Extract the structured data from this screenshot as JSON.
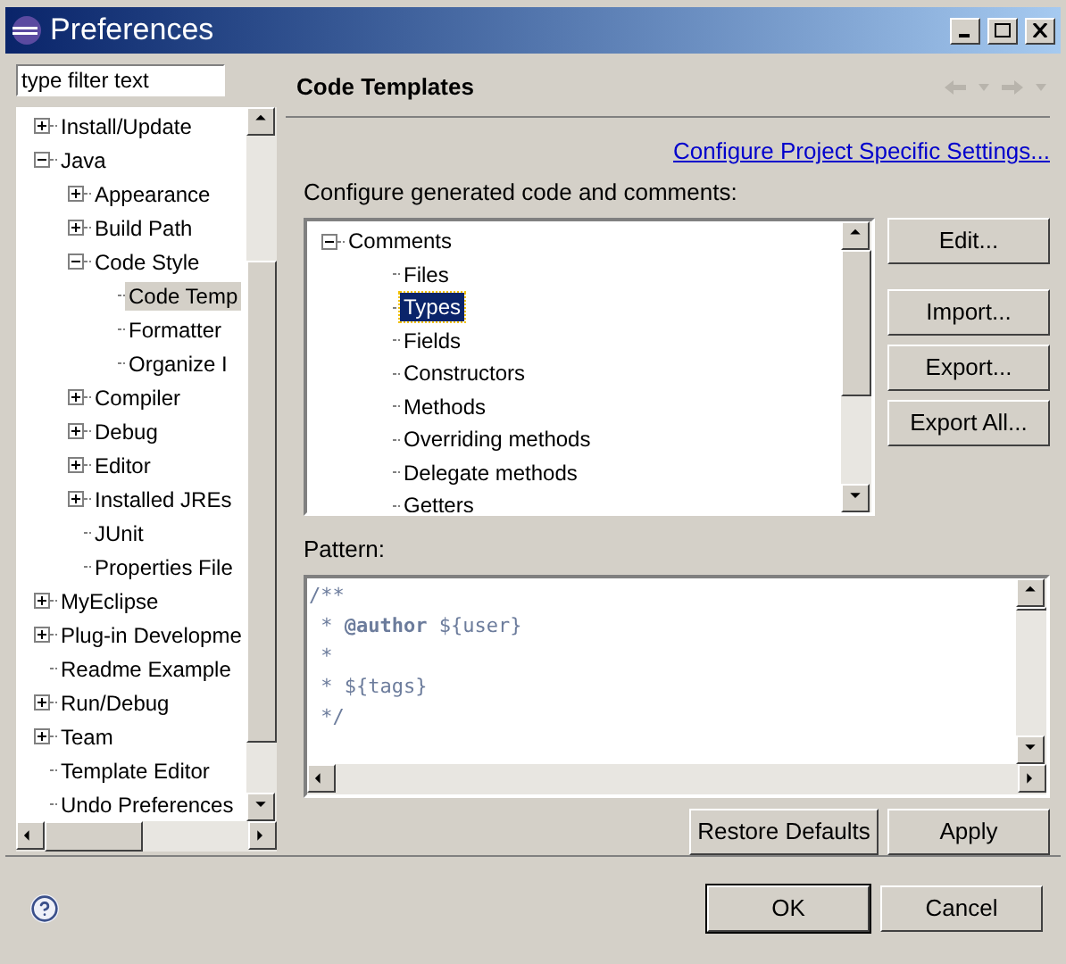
{
  "window": {
    "title": "Preferences"
  },
  "filter": {
    "value": "type filter text"
  },
  "nav_tree": [
    {
      "label": "Install/Update",
      "expanded": false,
      "selected": false
    },
    {
      "label": "Java",
      "expanded": true,
      "selected": false,
      "children": [
        {
          "label": "Appearance",
          "expanded": false,
          "selected": false
        },
        {
          "label": "Build Path",
          "expanded": false,
          "selected": false
        },
        {
          "label": "Code Style",
          "expanded": true,
          "selected": false,
          "children": [
            {
              "label": "Code Temp",
              "selected": true
            },
            {
              "label": "Formatter",
              "selected": false
            },
            {
              "label": "Organize I",
              "selected": false
            }
          ]
        },
        {
          "label": "Compiler",
          "expanded": false,
          "selected": false
        },
        {
          "label": "Debug",
          "expanded": false,
          "selected": false
        },
        {
          "label": "Editor",
          "expanded": false,
          "selected": false
        },
        {
          "label": "Installed JREs",
          "expanded": false,
          "selected": false
        },
        {
          "label": "JUnit",
          "selected": false
        },
        {
          "label": "Properties File",
          "selected": false
        }
      ]
    },
    {
      "label": "MyEclipse",
      "expanded": false,
      "selected": false
    },
    {
      "label": "Plug-in Developme",
      "expanded": false,
      "selected": false
    },
    {
      "label": "Readme Example",
      "selected": false
    },
    {
      "label": "Run/Debug",
      "expanded": false,
      "selected": false
    },
    {
      "label": "Team",
      "expanded": false,
      "selected": false
    },
    {
      "label": "Template Editor",
      "selected": false
    },
    {
      "label": "Undo Preferences",
      "selected": false
    }
  ],
  "page": {
    "title": "Code Templates",
    "link": "Configure Project Specific Settings...",
    "tree_label": "Configure generated code and comments:",
    "template_tree": [
      {
        "label": "Comments",
        "expanded": true,
        "selected": false,
        "children": [
          {
            "label": "Files",
            "selected": false
          },
          {
            "label": "Types",
            "selected": true
          },
          {
            "label": "Fields",
            "selected": false
          },
          {
            "label": "Constructors",
            "selected": false
          },
          {
            "label": "Methods",
            "selected": false
          },
          {
            "label": "Overriding methods",
            "selected": false
          },
          {
            "label": "Delegate methods",
            "selected": false
          },
          {
            "label": "Getters",
            "selected": false
          }
        ]
      }
    ],
    "side_buttons": [
      "Edit...",
      "Import...",
      "Export...",
      "Export All..."
    ],
    "pattern_label": "Pattern:",
    "pattern_lines": [
      "/**",
      " * **@author** ${user}",
      " *",
      " * ${tags}",
      " */"
    ],
    "page_buttons": [
      "Restore Defaults",
      "Apply"
    ]
  },
  "dialog_buttons": [
    "OK",
    "Cancel"
  ]
}
